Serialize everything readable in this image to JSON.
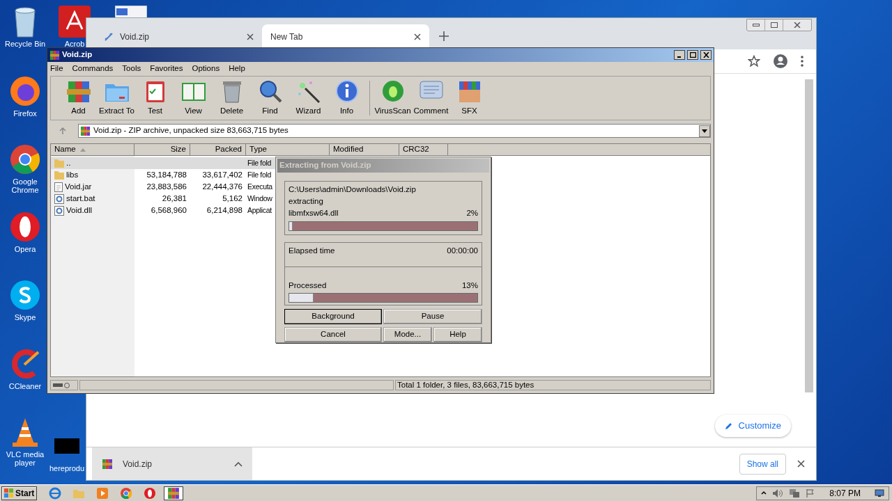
{
  "desktop_icons": [
    {
      "label": "Recycle Bin",
      "kind": "bin"
    },
    {
      "label": "Acrob",
      "kind": "acrobat"
    },
    {
      "label": "Firefox",
      "kind": "firefox"
    },
    {
      "label": "Google Chrome",
      "kind": "chrome"
    },
    {
      "label": "Opera",
      "kind": "opera"
    },
    {
      "label": "Skype",
      "kind": "skype"
    },
    {
      "label": "CCleaner",
      "kind": "ccleaner"
    },
    {
      "label": "VLC media player",
      "kind": "vlc"
    },
    {
      "label": "hereprodu",
      "kind": "black"
    }
  ],
  "browser": {
    "tabs": [
      {
        "label": "Void.zip",
        "selected": false
      },
      {
        "label": "New Tab",
        "selected": true
      }
    ],
    "customize": "Customize",
    "download_shelf": {
      "item": "Void.zip",
      "show_all": "Show all"
    }
  },
  "winrar": {
    "title": "Void.zip",
    "menu": [
      "File",
      "Commands",
      "Tools",
      "Favorites",
      "Options",
      "Help"
    ],
    "toolbar": [
      {
        "label": "Add",
        "kind": "add"
      },
      {
        "label": "Extract To",
        "kind": "extract"
      },
      {
        "label": "Test",
        "kind": "test"
      },
      {
        "label": "View",
        "kind": "view"
      },
      {
        "label": "Delete",
        "kind": "delete"
      },
      {
        "label": "Find",
        "kind": "find"
      },
      {
        "label": "Wizard",
        "kind": "wizard"
      },
      {
        "label": "Info",
        "kind": "info"
      },
      {
        "label": "VirusScan",
        "kind": "virus"
      },
      {
        "label": "Comment",
        "kind": "comment"
      },
      {
        "label": "SFX",
        "kind": "sfx"
      }
    ],
    "address": "Void.zip - ZIP archive, unpacked size 83,663,715 bytes",
    "columns": [
      "Name",
      "Size",
      "Packed",
      "Type",
      "Modified",
      "CRC32"
    ],
    "rows": [
      {
        "name": "..",
        "size": "",
        "packed": "",
        "type": "File fold",
        "kind": "folder",
        "selected": true
      },
      {
        "name": "libs",
        "size": "53,184,788",
        "packed": "33,617,402",
        "type": "File fold",
        "kind": "folder",
        "selected": false
      },
      {
        "name": "Void.jar",
        "size": "23,883,586",
        "packed": "22,444,376",
        "type": "Executa",
        "kind": "file",
        "selected": false
      },
      {
        "name": "start.bat",
        "size": "26,381",
        "packed": "5,162",
        "type": "Window",
        "kind": "gear",
        "selected": false
      },
      {
        "name": "Void.dll",
        "size": "6,568,960",
        "packed": "6,214,898",
        "type": "Applicat",
        "kind": "gear",
        "selected": false
      }
    ],
    "status": "Total 1 folder, 3 files, 83,663,715 bytes"
  },
  "dialog": {
    "title": "Extracting from Void.zip",
    "path": "C:\\Users\\admin\\Downloads\\Void.zip",
    "action": "extracting",
    "file": "libmfxsw64.dll",
    "file_percent": "2%",
    "file_progress": {
      "level": 0.02
    },
    "elapsed_label": "Elapsed time",
    "elapsed": "00:00:00",
    "processed_label": "Processed",
    "processed_percent": "13%",
    "processed_progress": {
      "level": 0.13
    },
    "buttons": [
      {
        "label": "Background",
        "default": true
      },
      {
        "label": "Pause",
        "default": false
      },
      {
        "label": "Cancel",
        "default": false
      },
      {
        "label": "Mode...",
        "default": false
      },
      {
        "label": "Help",
        "default": false
      }
    ]
  },
  "taskbar": {
    "start": "Start",
    "apps": [
      {
        "kind": "ie",
        "selected": false
      },
      {
        "kind": "explorer",
        "selected": false
      },
      {
        "kind": "media",
        "selected": false
      },
      {
        "kind": "chrome",
        "selected": false
      },
      {
        "kind": "opera",
        "selected": false
      },
      {
        "kind": "winrar",
        "selected": true
      }
    ],
    "clock": "8:07 PM"
  }
}
